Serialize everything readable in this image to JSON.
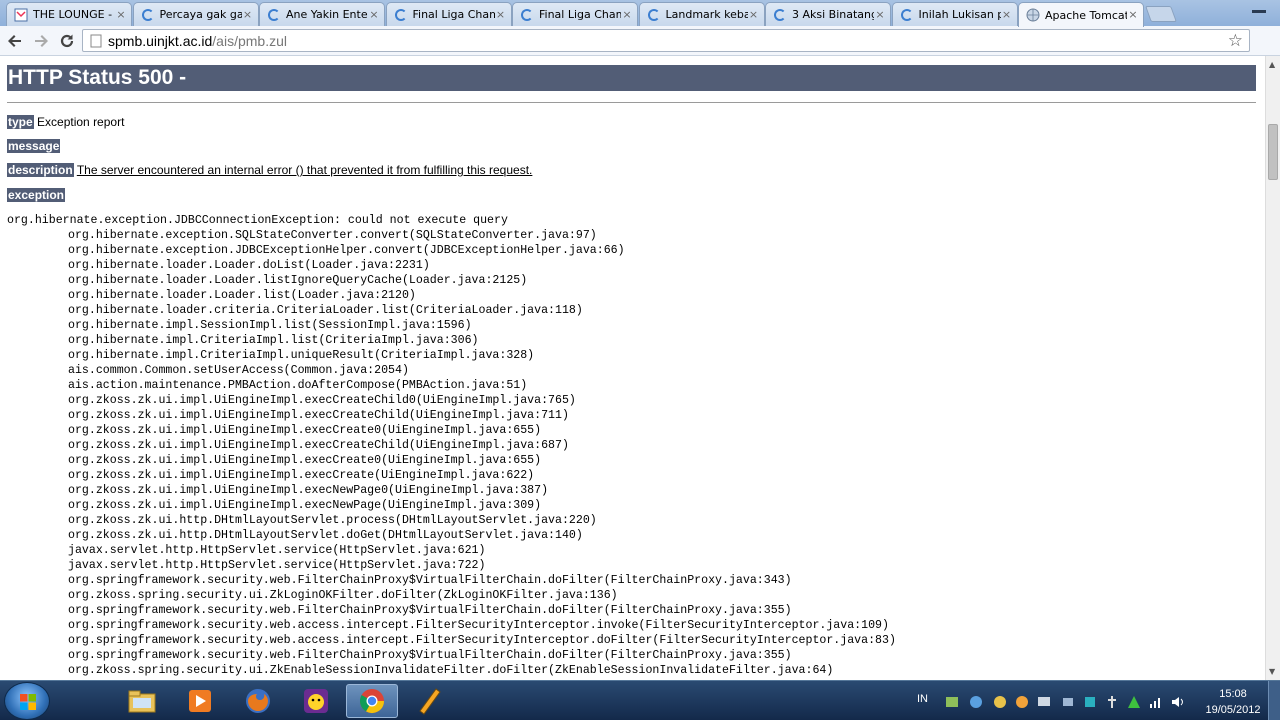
{
  "browser": {
    "tabs": [
      {
        "title": "THE LOUNGE - K",
        "icon": "kaskus-icon",
        "active": false
      },
      {
        "title": "Percaya gak gan",
        "icon": "loading-icon",
        "active": false
      },
      {
        "title": "Ane Yakin Ente B",
        "icon": "loading-icon",
        "active": false
      },
      {
        "title": "Final Liga Cham",
        "icon": "loading-icon",
        "active": false
      },
      {
        "title": "Final Liga Cham",
        "icon": "loading-icon",
        "active": false
      },
      {
        "title": "Landmark kebar",
        "icon": "loading-icon",
        "active": false
      },
      {
        "title": "3 Aksi Binatang",
        "icon": "loading-icon",
        "active": false
      },
      {
        "title": "Inilah Lukisan pe",
        "icon": "loading-icon",
        "active": false
      },
      {
        "title": "Apache Tomcat",
        "icon": "globe-icon",
        "active": true
      }
    ],
    "tab_close_glyph": "×",
    "address": {
      "host": "spmb.uinjkt.ac.id",
      "path": "/ais/pmb.zul"
    }
  },
  "page": {
    "heading": "HTTP Status 500 -",
    "type_label": "type",
    "type_value": "Exception report",
    "message_label": "message",
    "description_label": "description",
    "description_value": "The server encountered an internal error () that prevented it from fulfilling this request.",
    "exception_label": "exception",
    "trace": [
      "org.hibernate.exception.JDBCConnectionException: could not execute query",
      "org.hibernate.exception.SQLStateConverter.convert(SQLStateConverter.java:97)",
      "org.hibernate.exception.JDBCExceptionHelper.convert(JDBCExceptionHelper.java:66)",
      "org.hibernate.loader.Loader.doList(Loader.java:2231)",
      "org.hibernate.loader.Loader.listIgnoreQueryCache(Loader.java:2125)",
      "org.hibernate.loader.Loader.list(Loader.java:2120)",
      "org.hibernate.loader.criteria.CriteriaLoader.list(CriteriaLoader.java:118)",
      "org.hibernate.impl.SessionImpl.list(SessionImpl.java:1596)",
      "org.hibernate.impl.CriteriaImpl.list(CriteriaImpl.java:306)",
      "org.hibernate.impl.CriteriaImpl.uniqueResult(CriteriaImpl.java:328)",
      "ais.common.Common.setUserAccess(Common.java:2054)",
      "ais.action.maintenance.PMBAction.doAfterCompose(PMBAction.java:51)",
      "org.zkoss.zk.ui.impl.UiEngineImpl.execCreateChild0(UiEngineImpl.java:765)",
      "org.zkoss.zk.ui.impl.UiEngineImpl.execCreateChild(UiEngineImpl.java:711)",
      "org.zkoss.zk.ui.impl.UiEngineImpl.execCreate0(UiEngineImpl.java:655)",
      "org.zkoss.zk.ui.impl.UiEngineImpl.execCreateChild(UiEngineImpl.java:687)",
      "org.zkoss.zk.ui.impl.UiEngineImpl.execCreate0(UiEngineImpl.java:655)",
      "org.zkoss.zk.ui.impl.UiEngineImpl.execCreate(UiEngineImpl.java:622)",
      "org.zkoss.zk.ui.impl.UiEngineImpl.execNewPage0(UiEngineImpl.java:387)",
      "org.zkoss.zk.ui.impl.UiEngineImpl.execNewPage(UiEngineImpl.java:309)",
      "org.zkoss.zk.ui.http.DHtmlLayoutServlet.process(DHtmlLayoutServlet.java:220)",
      "org.zkoss.zk.ui.http.DHtmlLayoutServlet.doGet(DHtmlLayoutServlet.java:140)",
      "javax.servlet.http.HttpServlet.service(HttpServlet.java:621)",
      "javax.servlet.http.HttpServlet.service(HttpServlet.java:722)",
      "org.springframework.security.web.FilterChainProxy$VirtualFilterChain.doFilter(FilterChainProxy.java:343)",
      "org.zkoss.spring.security.ui.ZkLoginOKFilter.doFilter(ZkLoginOKFilter.java:136)",
      "org.springframework.security.web.FilterChainProxy$VirtualFilterChain.doFilter(FilterChainProxy.java:355)",
      "org.springframework.security.web.access.intercept.FilterSecurityInterceptor.invoke(FilterSecurityInterceptor.java:109)",
      "org.springframework.security.web.access.intercept.FilterSecurityInterceptor.doFilter(FilterSecurityInterceptor.java:83)",
      "org.springframework.security.web.FilterChainProxy$VirtualFilterChain.doFilter(FilterChainProxy.java:355)",
      "org.zkoss.spring.security.ui.ZkEnableSessionInvalidateFilter.doFilter(ZkEnableSessionInvalidateFilter.java:64)"
    ]
  },
  "taskbar": {
    "apps": [
      "explorer-icon",
      "media-player-icon",
      "firefox-icon",
      "yahoo-messenger-icon",
      "chrome-icon",
      "winamp-icon"
    ],
    "active_app": "chrome-icon",
    "language": "IN",
    "time": "15:08",
    "date": "19/05/2012"
  },
  "colors": {
    "tomcat_header": "#525d76",
    "taskbar": "#1b3559"
  }
}
